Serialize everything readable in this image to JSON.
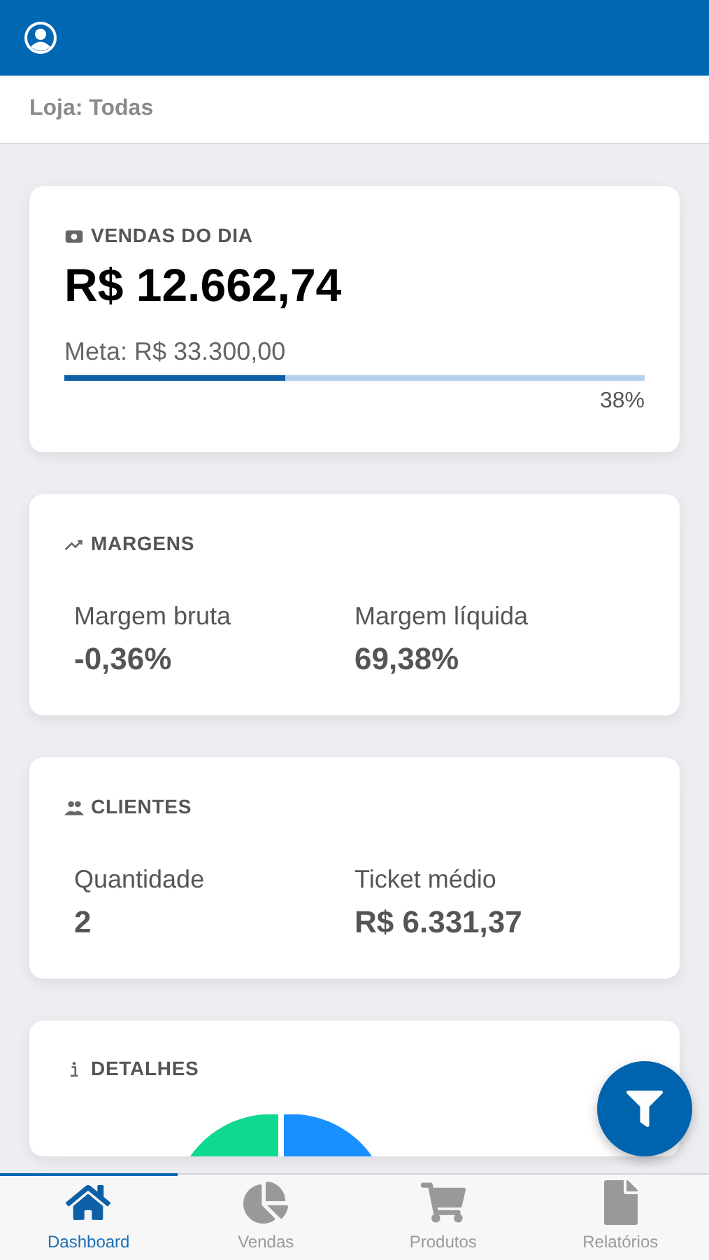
{
  "store_bar": {
    "label": "Loja: Todas"
  },
  "cards": [
    {
      "kind": "goal",
      "title": "VENDAS DO DIA",
      "amount": "R$ 12.662,74",
      "goal": "Meta: R$ 33.300,00",
      "level": 0.38,
      "percent": "38%"
    },
    {
      "kind": "pair",
      "title": "MARGENS",
      "metrics": [
        {
          "label": "Margem bruta",
          "value": "-0,36%"
        },
        {
          "label": "Margem líquida",
          "value": "69,38%"
        }
      ]
    },
    {
      "kind": "pair",
      "title": "CLIENTES",
      "metrics": [
        {
          "label": "Quantidade",
          "value": "2"
        },
        {
          "label": "Ticket médio",
          "value": "R$ 6.331,37"
        }
      ]
    },
    {
      "kind": "chart",
      "title": "DETALHES"
    }
  ],
  "tabs": [
    {
      "label": "Dashboard",
      "selected": true
    },
    {
      "label": "Vendas",
      "selected": false
    },
    {
      "label": "Produtos",
      "selected": false
    },
    {
      "label": "Relatórios",
      "selected": false
    }
  ]
}
